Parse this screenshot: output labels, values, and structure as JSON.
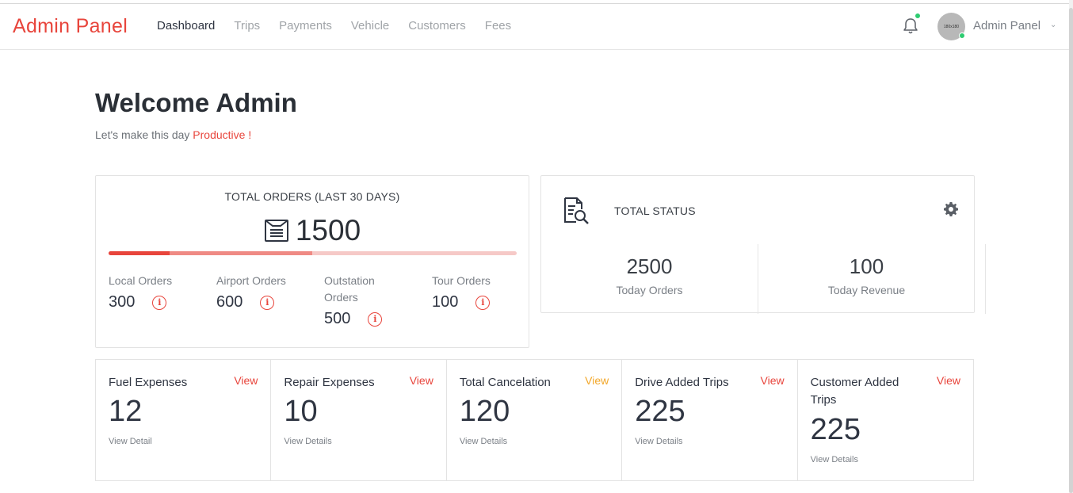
{
  "navbar": {
    "brand": "Admin Panel",
    "links": [
      "Dashboard",
      "Trips",
      "Payments",
      "Vehicle",
      "Customers",
      "Fees"
    ],
    "active": "Dashboard",
    "avatar_text": "180x180",
    "user_name": "Admin Panel"
  },
  "welcome": {
    "title": "Welcome Admin",
    "subtitle_prefix": "Let's make this day ",
    "subtitle_accent": "Productive !"
  },
  "orders": {
    "title": "TOTAL ORDERS (LAST 30 DAYS)",
    "total": "1500",
    "progress_fraction": 0.5,
    "columns": [
      {
        "label": "Local Orders",
        "value": "300",
        "info": "i"
      },
      {
        "label": "Airport Orders",
        "value": "600",
        "info": "i"
      },
      {
        "label": "Outstation Orders",
        "value": "500",
        "info": "i"
      },
      {
        "label": "Tour Orders",
        "value": "100",
        "info": "i"
      }
    ]
  },
  "status": {
    "title": "TOTAL STATUS",
    "stats": [
      {
        "value": "2500",
        "label": "Today Orders"
      },
      {
        "value": "100",
        "label": "Today Revenue"
      }
    ]
  },
  "cards": [
    {
      "title": "Fuel Expenses",
      "view": "View",
      "value": "12",
      "detail": "View Detail"
    },
    {
      "title": "Repair Expenses",
      "view": "View",
      "value": "10",
      "detail": "View Details"
    },
    {
      "title": "Total Cancelation",
      "view": "View",
      "value": "120",
      "detail": "View Details"
    },
    {
      "title": "Drive Added Trips",
      "view": "View",
      "value": "225",
      "detail": "View Details"
    },
    {
      "title": "Customer Added Trips",
      "view": "View",
      "value": "225",
      "detail": "View Details"
    }
  ],
  "colors": {
    "accent": "#e8453c",
    "orange": "#f2a72a",
    "online": "#2ecc71"
  },
  "icons": [
    "bell-icon",
    "avatar",
    "chevron-down-icon",
    "orders-list-icon",
    "info-icon",
    "document-search-icon",
    "gear-icon"
  ]
}
